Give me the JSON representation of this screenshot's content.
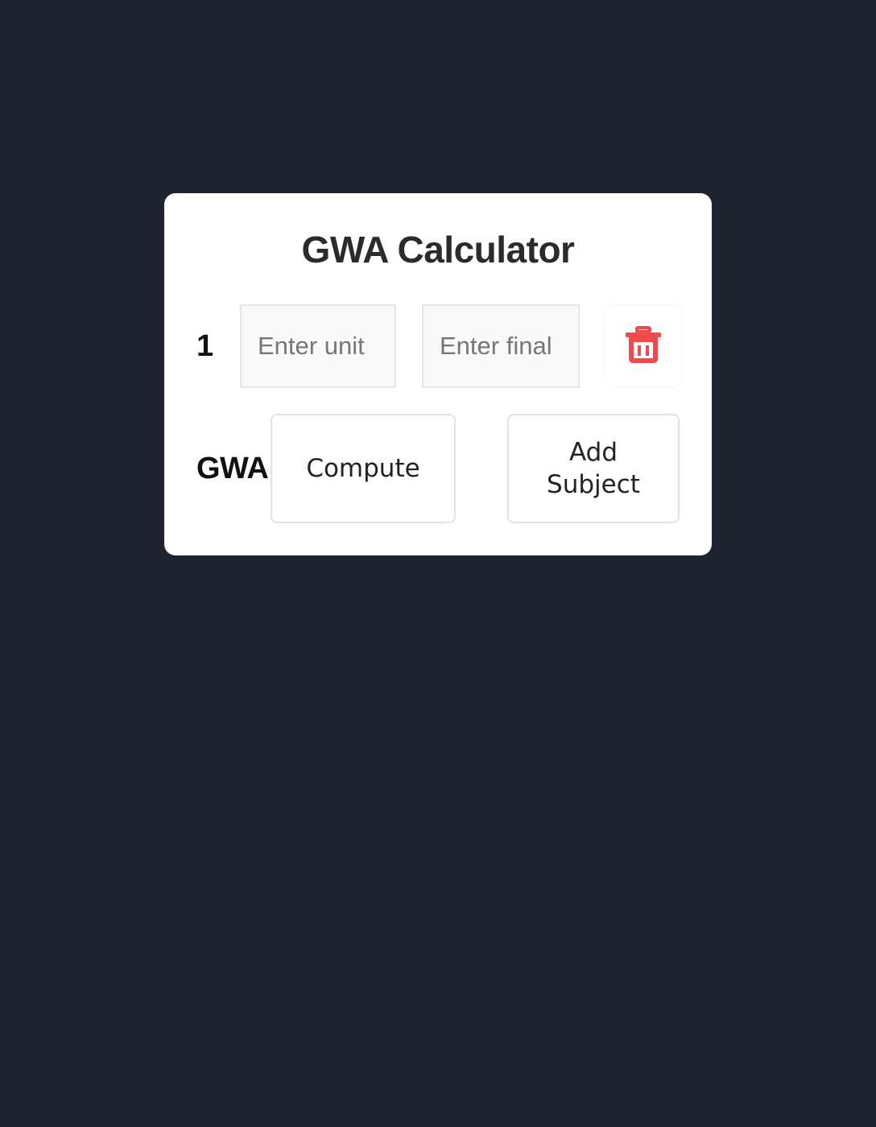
{
  "app": {
    "title": "GWA Calculator"
  },
  "subjects": [
    {
      "index": "1",
      "unit_placeholder": "Enter unit",
      "final_placeholder": "Enter final",
      "unit_value": "",
      "final_value": ""
    }
  ],
  "delete": {
    "icon": "trash-icon",
    "color": "#f04a4a"
  },
  "result": {
    "label": "GWA:",
    "value": ""
  },
  "actions": {
    "compute_label": "Compute",
    "add_label": "Add Subject"
  },
  "colors": {
    "background": "#1e2330",
    "card": "#ffffff",
    "accent_red": "#f04a4a"
  }
}
